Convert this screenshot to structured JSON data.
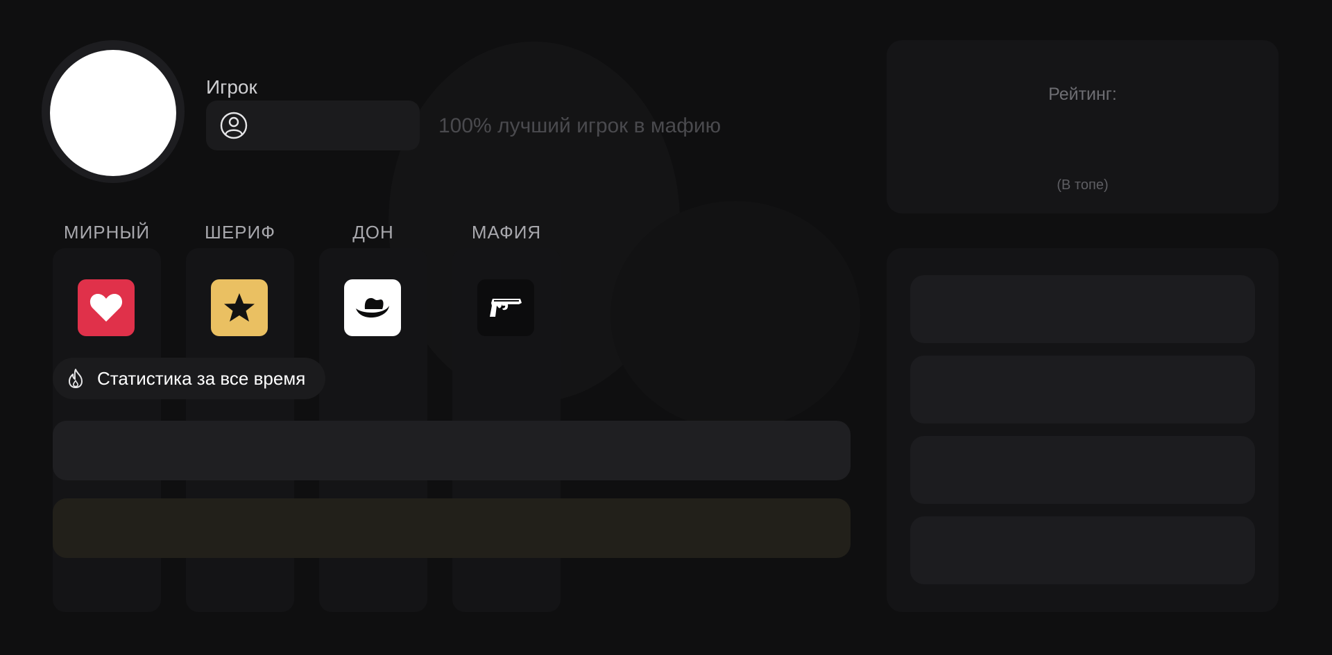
{
  "profile": {
    "username_label": "Игрок",
    "status_text": "100% лучший игрок в мафию",
    "icons": {
      "avatar": "avatar-circle",
      "user": "user-circle-icon"
    }
  },
  "roles": [
    {
      "label": "МИРНЫЙ",
      "icon": "heart-icon",
      "color": "#e0314a"
    },
    {
      "label": "ШЕРИФ",
      "icon": "star-icon",
      "color": "#eac062"
    },
    {
      "label": "ДОН",
      "icon": "hat-icon",
      "color": "#ffffff"
    },
    {
      "label": "МАФИЯ",
      "icon": "pistol-icon",
      "color": "#0c0c0d"
    }
  ],
  "stats": {
    "label": "Статистика за все время",
    "icon": "fire-icon"
  },
  "rating": {
    "label": "Рейтинг:",
    "position_note": "(В топе)"
  },
  "colors": {
    "background": "#0f0f10",
    "panel": "#141416",
    "bar_gray": "#1f1f22",
    "bar_gold": "#22201a"
  }
}
